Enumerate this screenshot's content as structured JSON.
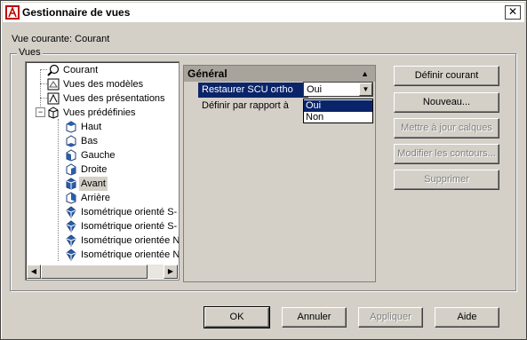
{
  "window": {
    "title": "Gestionnaire de vues",
    "close_glyph": "✕"
  },
  "current_view_label": "Vue courante: Courant",
  "group_label": "Vues",
  "tree": {
    "items": [
      {
        "label": "Courant",
        "icon": "magnifier-icon"
      },
      {
        "label": "Vues des modèles",
        "icon": "model-views-icon"
      },
      {
        "label": "Vues des présentations",
        "icon": "layout-views-icon"
      },
      {
        "label": "Vues prédéfinies",
        "icon": "cube-icon",
        "expander": "−"
      },
      {
        "label": "Haut",
        "icon": "cube-top-icon"
      },
      {
        "label": "Bas",
        "icon": "cube-bottom-icon"
      },
      {
        "label": "Gauche",
        "icon": "cube-left-icon"
      },
      {
        "label": "Droite",
        "icon": "cube-right-icon"
      },
      {
        "label": "Avant",
        "icon": "cube-front-icon",
        "selected": true
      },
      {
        "label": "Arrière",
        "icon": "cube-back-icon"
      },
      {
        "label": "Isométrique orienté S-",
        "icon": "iso-icon"
      },
      {
        "label": "Isométrique orienté S-",
        "icon": "iso-icon"
      },
      {
        "label": "Isométrique orientée N",
        "icon": "iso-icon"
      },
      {
        "label": "Isométrique orientée N",
        "icon": "iso-icon"
      }
    ]
  },
  "properties": {
    "header": "Général",
    "rows": [
      {
        "label": "Restaurer SCU ortho",
        "selected": true
      },
      {
        "label": "Définir par rapport à",
        "selected": false
      }
    ],
    "combo_value": "Oui",
    "dropdown_options": [
      {
        "label": "Oui",
        "selected": true
      },
      {
        "label": "Non",
        "selected": false
      }
    ]
  },
  "side_buttons": {
    "set_current": "Définir courant",
    "new": "Nouveau...",
    "update_layers": "Mettre à jour calques",
    "edit_boundaries": "Modifier les contours...",
    "delete": "Supprimer"
  },
  "bottom_buttons": {
    "ok": "OK",
    "cancel": "Annuler",
    "apply": "Appliquer",
    "help": "Aide"
  },
  "colors": {
    "selection": "#0a246a",
    "face": "#d4d0c8",
    "cube_blue": "#2a5ea8"
  }
}
